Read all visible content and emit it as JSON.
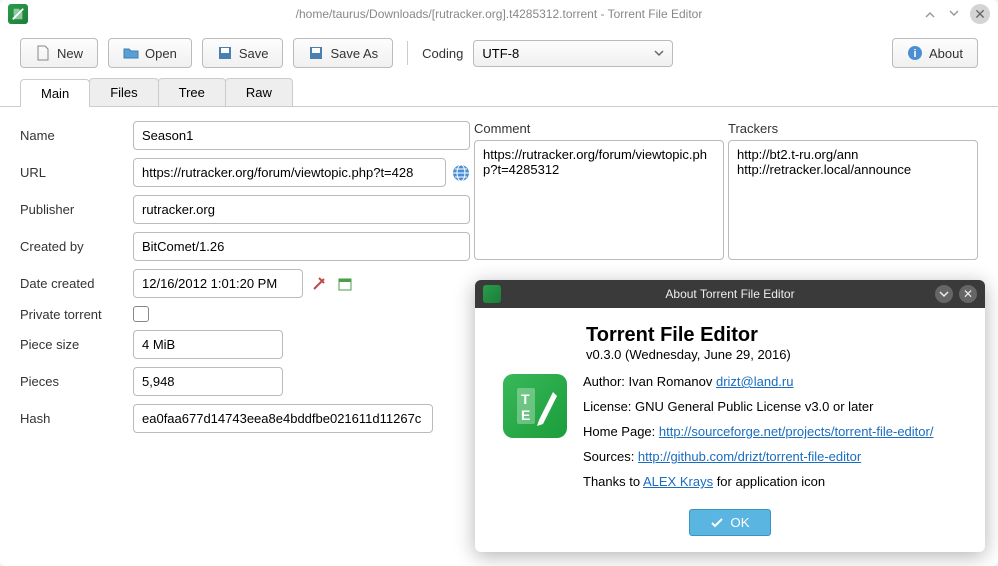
{
  "window": {
    "title": "/home/taurus/Downloads/[rutracker.org].t4285312.torrent - Torrent File Editor"
  },
  "toolbar": {
    "new_label": "New",
    "open_label": "Open",
    "save_label": "Save",
    "saveas_label": "Save As",
    "coding_label": "Coding",
    "coding_value": "UTF-8",
    "about_label": "About"
  },
  "tabs": {
    "main": "Main",
    "files": "Files",
    "tree": "Tree",
    "raw": "Raw"
  },
  "form": {
    "name_label": "Name",
    "name_value": "Season1",
    "url_label": "URL",
    "url_value": "https://rutracker.org/forum/viewtopic.php?t=428",
    "publisher_label": "Publisher",
    "publisher_value": "rutracker.org",
    "createdby_label": "Created by",
    "createdby_value": "BitComet/1.26",
    "datecreated_label": "Date created",
    "datecreated_value": "12/16/2012 1:01:20 PM",
    "private_label": "Private torrent",
    "piecesize_label": "Piece size",
    "piecesize_value": "4 MiB",
    "pieces_label": "Pieces",
    "pieces_value": "5,948",
    "hash_label": "Hash",
    "hash_value": "ea0faa677d14743eea8e4bddfbe021611d11267c"
  },
  "comment": {
    "label": "Comment",
    "value": "https://rutracker.org/forum/viewtopic.php?t=4285312"
  },
  "trackers": {
    "label": "Trackers",
    "value": "http://bt2.t-ru.org/ann\nhttp://retracker.local/announce"
  },
  "about": {
    "title": "About Torrent File Editor",
    "app_name": "Torrent File Editor",
    "version": "v0.3.0 (Wednesday, June 29, 2016)",
    "author_label": "Author: Ivan Romanov ",
    "author_email": "drizt@land.ru",
    "license": "License: GNU General Public License v3.0 or later",
    "homepage_label": "Home Page: ",
    "homepage_url": "http://sourceforge.net/projects/torrent-file-editor/",
    "sources_label": "Sources: ",
    "sources_url": "http://github.com/drizt/torrent-file-editor",
    "thanks_pre": "Thanks to ",
    "thanks_name": "ALEX Krays",
    "thanks_post": " for application icon",
    "ok_label": "OK"
  }
}
